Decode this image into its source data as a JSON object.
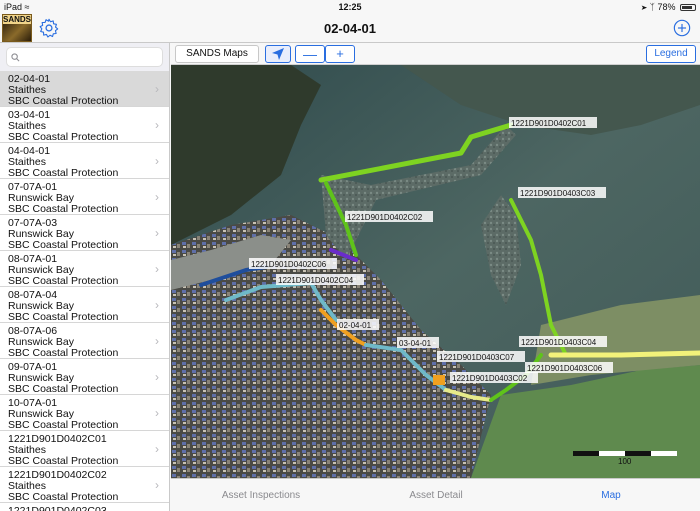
{
  "status": {
    "device": "iPad",
    "time": "12:25",
    "battery": "78%"
  },
  "header": {
    "logo_text": "SANDS",
    "title": "02-04-01"
  },
  "search": {
    "placeholder": ""
  },
  "assets": [
    {
      "code": "02-04-01",
      "location": "Staithes",
      "owner": "SBC Coastal Protection",
      "selected": true
    },
    {
      "code": "03-04-01",
      "location": "Staithes",
      "owner": "SBC Coastal Protection"
    },
    {
      "code": "04-04-01",
      "location": "Staithes",
      "owner": "SBC Coastal Protection"
    },
    {
      "code": "07-07A-01",
      "location": "Runswick Bay",
      "owner": "SBC Coastal Protection"
    },
    {
      "code": "07-07A-03",
      "location": "Runswick Bay",
      "owner": "SBC Coastal Protection"
    },
    {
      "code": "08-07A-01",
      "location": "Runswick Bay",
      "owner": "SBC Coastal Protection"
    },
    {
      "code": "08-07A-04",
      "location": "Runswick Bay",
      "owner": "SBC Coastal Protection"
    },
    {
      "code": "08-07A-06",
      "location": "Runswick Bay",
      "owner": "SBC Coastal Protection"
    },
    {
      "code": "09-07A-01",
      "location": "Runswick Bay",
      "owner": "SBC Coastal Protection"
    },
    {
      "code": "10-07A-01",
      "location": "Runswick Bay",
      "owner": "SBC Coastal Protection"
    },
    {
      "code": "1221D901D0402C01",
      "location": "Staithes",
      "owner": "SBC Coastal Protection"
    },
    {
      "code": "1221D901D0402C02",
      "location": "Staithes",
      "owner": "SBC Coastal Protection"
    },
    {
      "code": "1221D901D0402C03",
      "location": "",
      "owner": ""
    }
  ],
  "toolbar": {
    "maps_label": "SANDS Maps",
    "minus_label": "—",
    "plus_label": "+",
    "legend_label": "Legend"
  },
  "map": {
    "labels": {
      "a0402c01": "1221D901D0402C01",
      "a0403c03": "1221D901D0403C03",
      "a0402c02": "1221D901D0402C02",
      "a0402c06": "1221D901D0402C06",
      "a0402c04": "1221D901D0402C04",
      "a020401": "02-04-01",
      "a030401": "03-04-01",
      "a0403c04": "1221D901D0403C04",
      "a0403c07": "1221D901D0403C07",
      "a0403c06": "1221D901D0403C06",
      "a0403c02": "1221D901D0403C02"
    },
    "scale_label": "100",
    "colors": {
      "green": "#7ed321",
      "teal": "#6fb9c8",
      "orange": "#f0a020",
      "navy": "#1f4e9c",
      "purple": "#6a2ccb",
      "yellow": "#f2f27a"
    }
  },
  "tabs": [
    {
      "label": "Asset Inspections",
      "active": false
    },
    {
      "label": "Asset Detail",
      "active": false
    },
    {
      "label": "Map",
      "active": true
    }
  ]
}
